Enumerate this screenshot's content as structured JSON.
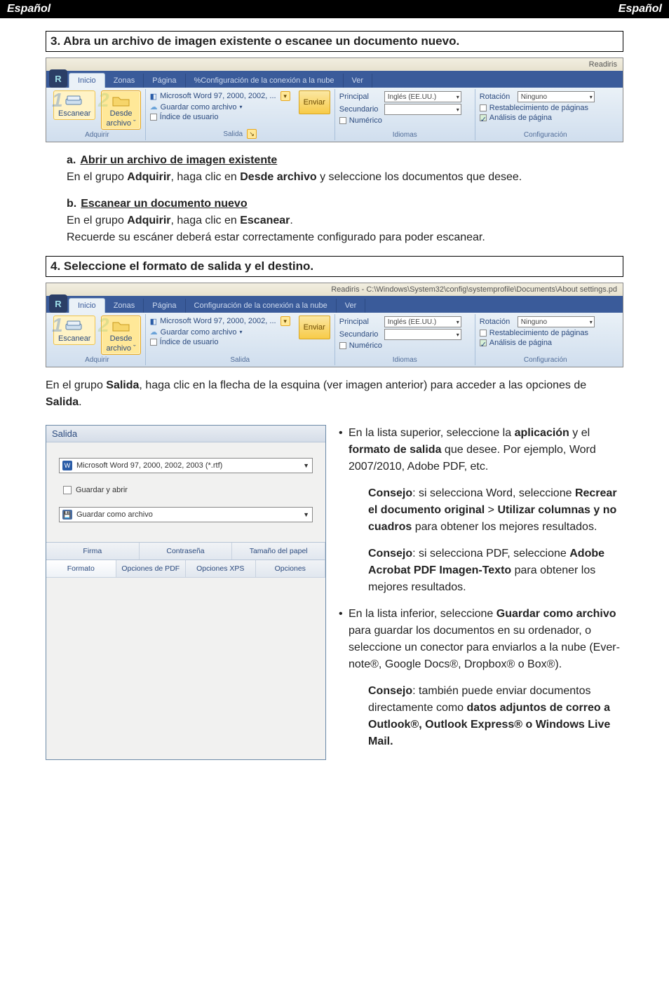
{
  "header": {
    "left": "Español",
    "right": "Español"
  },
  "step3": {
    "title": "3. Abra un archivo de imagen existente o escanee un documento nuevo.",
    "a_lead": "a.",
    "a_sub": "Abrir un archivo de imagen existente",
    "a_body_1": "En el grupo ",
    "a_body_bold1": "Adquirir",
    "a_body_2": ", haga clic en ",
    "a_body_bold2": "Desde archivo",
    "a_body_3": " y seleccione los documentos que desee.",
    "b_lead": "b.",
    "b_sub": "Escanear un documento nuevo",
    "b_line1_1": "En el grupo ",
    "b_line1_bold1": "Adquirir",
    "b_line1_2": ", haga clic en ",
    "b_line1_bold2": "Escanear",
    "b_line1_3": ".",
    "b_line2": "Recuerde su escáner deberá estar correctamente configurado para poder escanear."
  },
  "ribbon1": {
    "app_title_right": "Readiris",
    "tabs": [
      "Inicio",
      "Zonas",
      "Página",
      "%Configuración de la conexión a la nube",
      "Ver"
    ],
    "acquire": {
      "scan": "Escanear",
      "from_file_1": "Desde",
      "from_file_2": "archivo ˇ",
      "group": "Adquirir"
    },
    "output": {
      "line1": "Microsoft Word 97, 2000, 2002, ...",
      "line2": "Guardar como archivo",
      "line3": "Índice de usuario",
      "send": "Enviar",
      "group": "Salida"
    },
    "lang": {
      "principal_lbl": "Principal",
      "principal_val": "Inglés (EE.UU.)",
      "secund_lbl": "Secundario",
      "numer_lbl": "Numérico",
      "group": "Idiomas"
    },
    "config": {
      "rot_lbl": "Rotación",
      "rot_val": "Ninguno",
      "restab": "Restablecimiento de páginas",
      "analisis": "Análisis de página",
      "group": "Configuración"
    }
  },
  "step4": {
    "title": "4. Seleccione el formato de salida y el destino."
  },
  "ribbon2": {
    "app_title_right": "Readiris - C:\\Windows\\System32\\config\\systemprofile\\Documents\\About settings.pd",
    "tabs": [
      "Inicio",
      "Zonas",
      "Página",
      "Configuración de la conexión a la nube",
      "Ver"
    ]
  },
  "after_ribbon2_1": "En el grupo ",
  "after_ribbon2_bold": "Salida",
  "after_ribbon2_2": ", haga clic en la flecha de la esquina (ver imagen anterior) para acceder a las opciones de ",
  "after_ribbon2_bold2": "Salida",
  "after_ribbon2_3": ".",
  "dialog": {
    "title": "Salida",
    "combo1": "Microsoft Word 97, 2000, 2002, 2003 (*.rtf)",
    "chk1": "Guardar y abrir",
    "combo2": "Guardar como archivo",
    "tabs": [
      "Firma",
      "Contraseña",
      "Tamaño del papel",
      "Formato",
      "Opciones de PDF",
      "Opciones XPS",
      "Opciones"
    ]
  },
  "tips": {
    "p1_bullet_a": "En la lista superior, seleccione la ",
    "p1_bold1": "apli­cación",
    "p1_mid": " y el ",
    "p1_bold2": "formato de salida",
    "p1_b": " que desee. Por ejemplo, Word 2007/2010, Adobe PDF, etc.",
    "c1_lead": "Consejo",
    "c1_a": ": si selecciona Word, seleccione ",
    "c1_bold1": "Recrear el documento original",
    "c1_mid": " > ",
    "c1_bold2": "Utilizar columnas y no cuadros",
    "c1_b": " para obtener los mejores resultados.",
    "c2_lead": "Consejo",
    "c2_a": ": si selecciona PDF, seleccione ",
    "c2_bold1": "Adobe Acrobat PDF Imagen-Texto",
    "c2_b": " para obtener los mejores resultados.",
    "p2_a": "En la lista inferior, seleccione ",
    "p2_bold1": "Guardar como archivo",
    "p2_b": " para guardar los docu­mentos en su ordenador, o seleccione un conector para enviarlos a la nube (Ever­note®, Google Docs®, Dropbox® o Box®).",
    "c3_lead": "Consejo",
    "c3_a": ": también puede enviar documentos directamente como ",
    "c3_bold1": "datos adjuntos de correo a Outlook®, Outlook Express® o Windows Live Mail."
  }
}
